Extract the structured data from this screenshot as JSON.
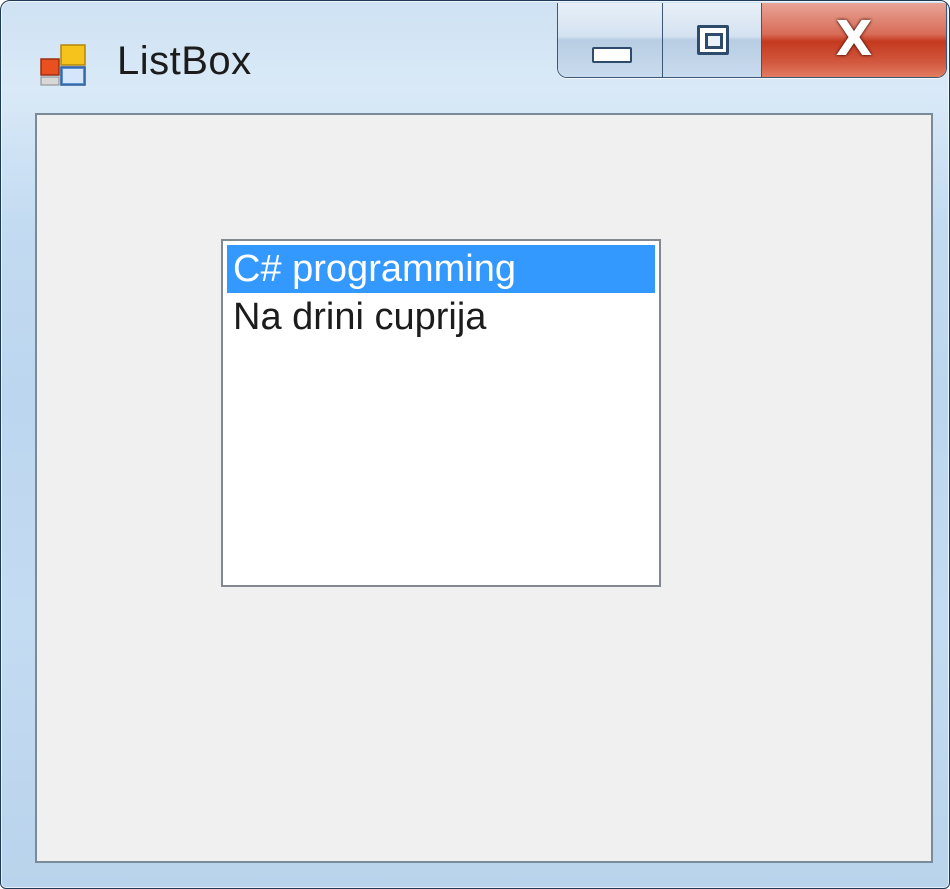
{
  "window": {
    "title": "ListBox",
    "icon": "winforms-app-icon"
  },
  "caption_buttons": {
    "minimize": "minimize-icon",
    "maximize": "maximize-icon",
    "close_label": "X"
  },
  "listbox": {
    "items": [
      {
        "label": "C# programming",
        "selected": true
      },
      {
        "label": "Na drini cuprija",
        "selected": false
      }
    ]
  },
  "colors": {
    "selection": "#3399ff",
    "client_bg": "#f0f0f0",
    "close_button": "#c4391f"
  }
}
